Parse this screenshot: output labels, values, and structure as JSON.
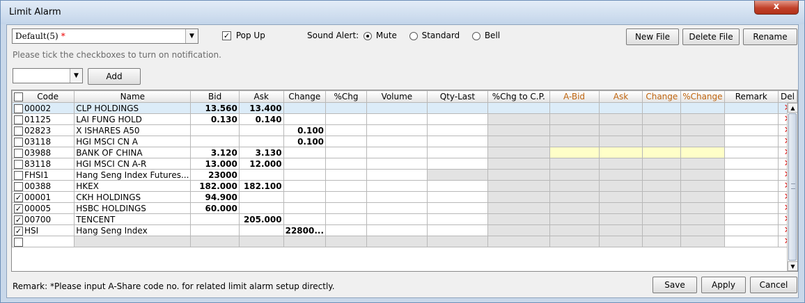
{
  "window": {
    "title": "Limit Alarm",
    "close_label": "x"
  },
  "top": {
    "file_value": "Default(5)",
    "file_marker": "*",
    "popup_label": "Pop Up",
    "sound_label": "Sound Alert:",
    "sound_options": [
      "Mute",
      "Standard",
      "Bell"
    ],
    "sound_selected": "Mute",
    "new_file": "New File",
    "delete_file": "Delete File",
    "rename": "Rename"
  },
  "hint": "Please tick the checkboxes to turn on notification.",
  "add": {
    "input_value": "",
    "button": "Add"
  },
  "table": {
    "columns": [
      "Code",
      "Name",
      "Bid",
      "Ask",
      "Change",
      "%Chg",
      "Volume",
      "Qty-Last",
      "%Chg to C.P.",
      "A-Bid",
      "Ask",
      "Change",
      "%Change",
      "Remark",
      "Del"
    ],
    "rows": [
      {
        "checked": false,
        "code": "00002",
        "name": "CLP HOLDINGS",
        "bid": "13.560",
        "ask": "13.400",
        "change": ""
      },
      {
        "checked": false,
        "code": "01125",
        "name": "LAI FUNG HOLD",
        "bid": "0.130",
        "ask": "0.140",
        "change": ""
      },
      {
        "checked": false,
        "code": "02823",
        "name": "X ISHARES A50",
        "bid": "",
        "ask": "",
        "change": "0.100"
      },
      {
        "checked": false,
        "code": "03118",
        "name": "HGI MSCI CN A",
        "bid": "",
        "ask": "",
        "change": "0.100"
      },
      {
        "checked": false,
        "code": "03988",
        "name": "BANK OF CHINA",
        "bid": "3.120",
        "ask": "3.130",
        "change": ""
      },
      {
        "checked": false,
        "code": "83118",
        "name": "HGI MSCI CN A-R",
        "bid": "13.000",
        "ask": "12.000",
        "change": ""
      },
      {
        "checked": false,
        "code": "FHSI1",
        "name": "Hang Seng Index Futures...",
        "bid": "23000",
        "ask": "",
        "change": ""
      },
      {
        "checked": false,
        "code": "00388",
        "name": "HKEX",
        "bid": "182.000",
        "ask": "182.100",
        "change": ""
      },
      {
        "checked": true,
        "code": "00001",
        "name": "CKH HOLDINGS",
        "bid": "94.900",
        "ask": "",
        "change": ""
      },
      {
        "checked": true,
        "code": "00005",
        "name": "HSBC HOLDINGS",
        "bid": "60.000",
        "ask": "",
        "change": ""
      },
      {
        "checked": true,
        "code": "00700",
        "name": "TENCENT",
        "bid": "",
        "ask": "205.000",
        "change": ""
      },
      {
        "checked": true,
        "code": "HSI",
        "name": "Hang Seng Index",
        "bid": "",
        "ask": "",
        "change": "22800..."
      },
      {
        "checked": false,
        "code": "",
        "name": "",
        "bid": "",
        "ask": "",
        "change": ""
      }
    ],
    "del_glyph": "✕"
  },
  "footer": {
    "remark": "Remark: *Please input A-Share code no. for related limit alarm setup directly.",
    "save": "Save",
    "apply": "Apply",
    "cancel": "Cancel"
  }
}
